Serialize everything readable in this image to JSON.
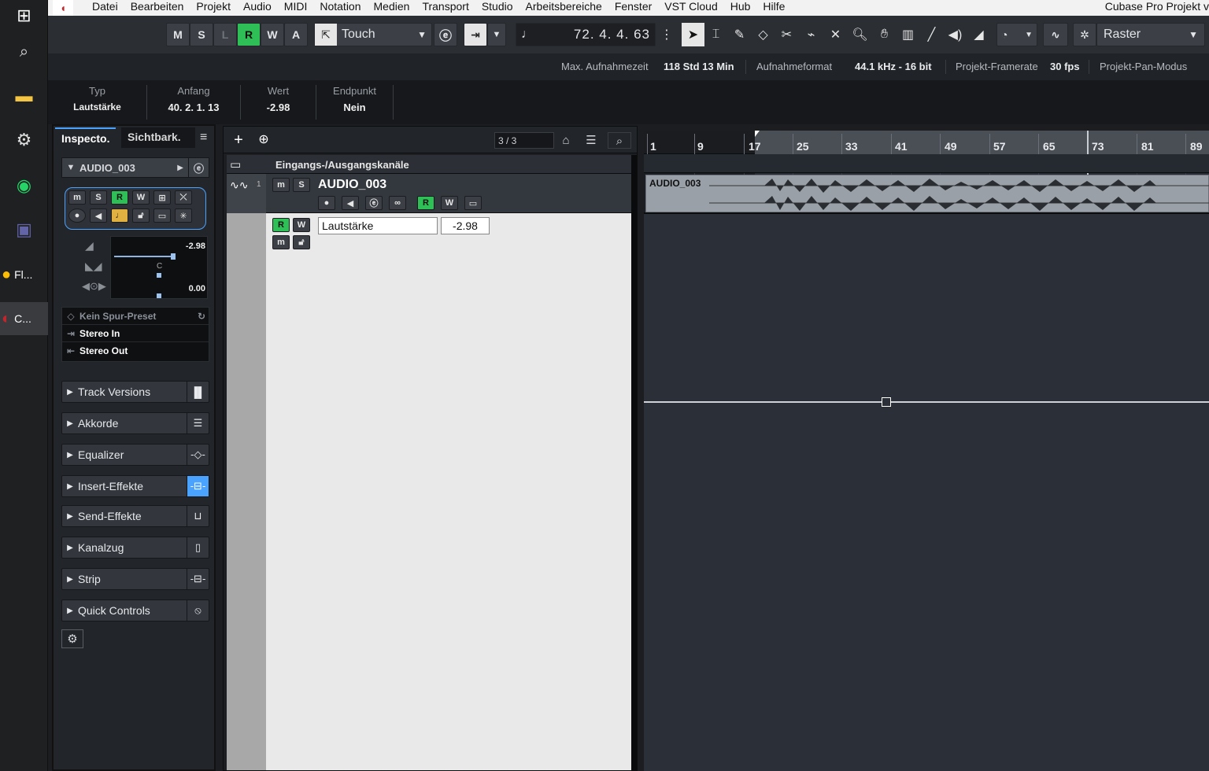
{
  "taskbar": {
    "apps": [
      {
        "label": "Fl..."
      },
      {
        "label": "C..."
      }
    ]
  },
  "menubar": {
    "items": [
      "Datei",
      "Bearbeiten",
      "Projekt",
      "Audio",
      "MIDI",
      "Notation",
      "Medien",
      "Transport",
      "Studio",
      "Arbeitsbereiche",
      "Fenster",
      "VST Cloud",
      "Hub",
      "Hilfe"
    ],
    "window_title": "Cubase Pro Projekt v"
  },
  "toolbar": {
    "state_buttons": [
      "M",
      "S",
      "L",
      "R",
      "W",
      "A"
    ],
    "automation_mode": "Touch",
    "position": "72. 4. 4. 63",
    "snap_type": "Raster"
  },
  "status": {
    "max_rec_label": "Max. Aufnahmezeit",
    "max_rec_value": "118 Std 13 Min",
    "rec_format_label": "Aufnahmeformat",
    "rec_format_value": "44.1 kHz - 16 bit",
    "framerate_label": "Projekt-Framerate",
    "framerate_value": "30 fps",
    "pan_label": "Projekt-Pan-Modus"
  },
  "infoline": {
    "typ_label": "Typ",
    "typ_value": "Lautstärke",
    "anfang_label": "Anfang",
    "anfang_value": "40. 2. 1. 13",
    "wert_label": "Wert",
    "wert_value": "-2.98",
    "end_label": "Endpunkt",
    "end_value": "Nein"
  },
  "inspector": {
    "tab_inspector": "Inspecto.",
    "tab_visibility": "Sichtbark.",
    "track_name": "AUDIO_003",
    "volume": "-2.98",
    "pan_center": "C",
    "pan_value": "0.00",
    "preset": "Kein Spur-Preset",
    "input": "Stereo In",
    "output": "Stereo Out",
    "sections": [
      "Track Versions",
      "Akkorde",
      "Equalizer",
      "Insert-Effekte",
      "Send-Effekte",
      "Kanalzug",
      "Strip",
      "Quick Controls"
    ]
  },
  "tracklist": {
    "count": "3 / 3",
    "folder_name": "Eingangs-/Ausgangskanäle",
    "track_number": "1",
    "track_name": "AUDIO_003",
    "automation_param": "Lautstärke",
    "automation_value": "-2.98"
  },
  "arrange": {
    "bars": [
      "1",
      "9",
      "17",
      "25",
      "33",
      "41",
      "49",
      "57",
      "65",
      "73",
      "81",
      "89"
    ],
    "event_name": "AUDIO_003"
  },
  "colors": {
    "accent_green": "#2fbf57",
    "cubase_red": "#c0262d"
  }
}
